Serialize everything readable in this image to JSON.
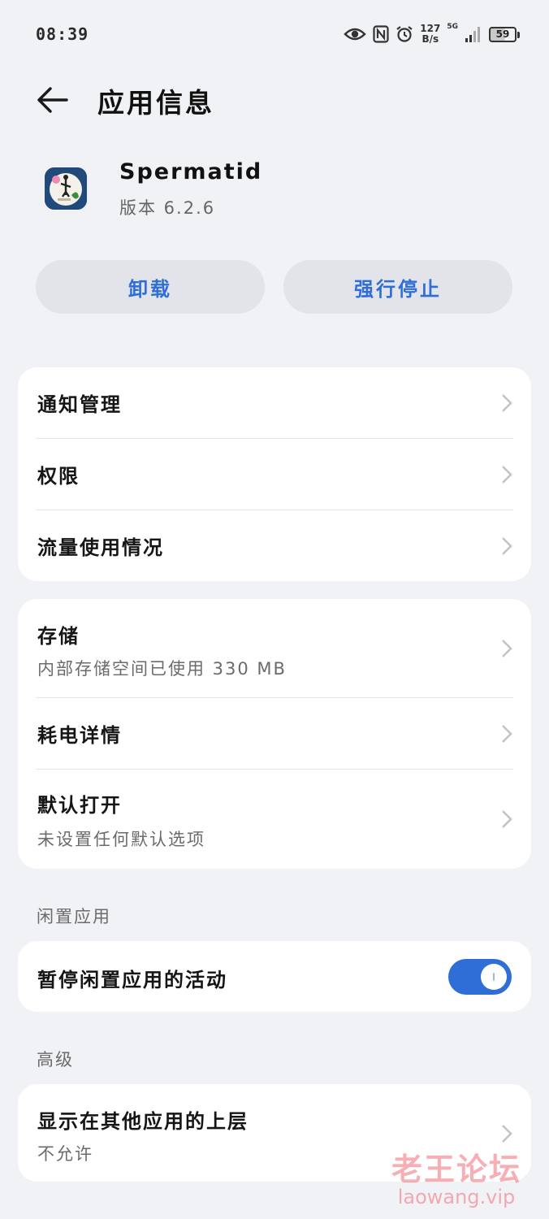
{
  "status_bar": {
    "time": "08:39",
    "net_speed_value": "127",
    "net_speed_unit": "B/s",
    "signal_label": "5G",
    "battery": "59",
    "icons": [
      "eye-icon",
      "nfc-icon",
      "alarm-icon",
      "signal-icon",
      "battery-icon"
    ]
  },
  "header": {
    "title": "应用信息"
  },
  "app": {
    "name": "Spermatid",
    "version": "版本 6.2.6"
  },
  "actions": {
    "uninstall": "卸载",
    "force_stop": "强行停止"
  },
  "card1": {
    "items": [
      {
        "label": "通知管理"
      },
      {
        "label": "权限"
      },
      {
        "label": "流量使用情况"
      }
    ]
  },
  "card2": {
    "storage_label": "存储",
    "storage_sub": "内部存储空间已使用 330 MB",
    "battery_label": "耗电详情",
    "default_label": "默认打开",
    "default_sub": "未设置任何默认选项"
  },
  "idle_section": {
    "title": "闲置应用",
    "toggle_label": "暂停闲置应用的活动",
    "toggle_on": true
  },
  "advanced_section": {
    "title": "高级",
    "overlay_label": "显示在其他应用的上层",
    "overlay_sub": "不允许"
  },
  "watermark": {
    "main": "老王论坛",
    "sub": "laowang.vip"
  },
  "colors": {
    "accent": "#2e6ed6",
    "background": "#f1f2f6",
    "card": "#ffffff"
  }
}
